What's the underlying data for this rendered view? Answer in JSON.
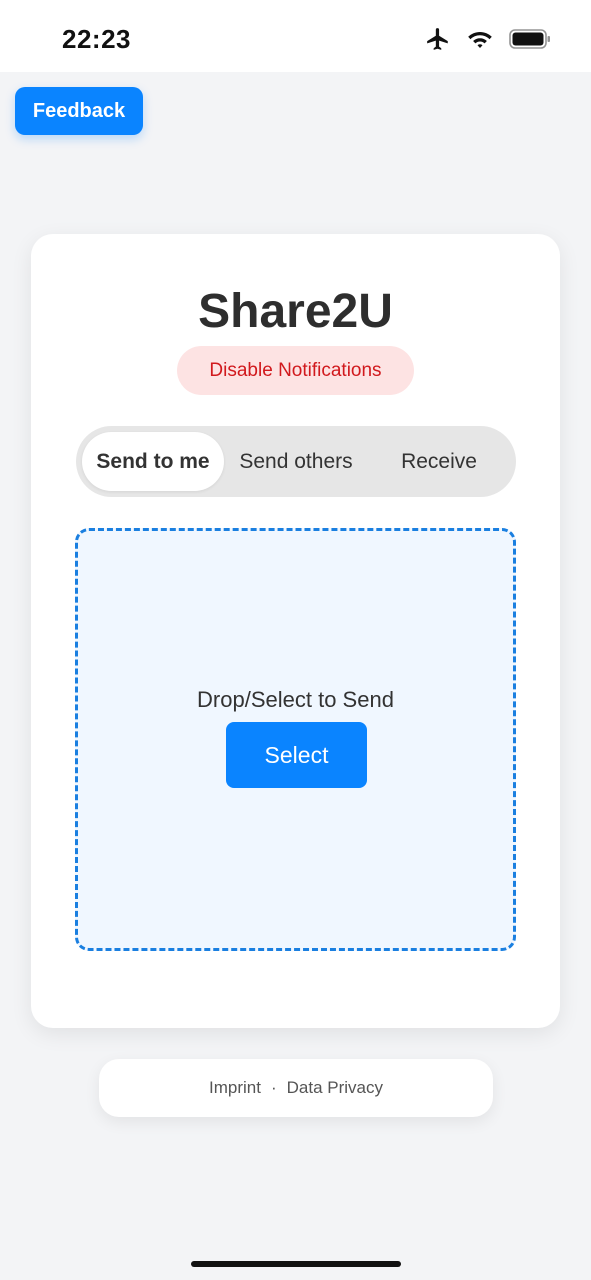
{
  "status_bar": {
    "time": "22:23",
    "icons": [
      "airplane-icon",
      "wifi-icon",
      "battery-icon"
    ]
  },
  "feedback_label": "Feedback",
  "app": {
    "title": "Share2U",
    "notifications_button": "Disable Notifications"
  },
  "tabs": [
    {
      "label": "Send to me",
      "active": true
    },
    {
      "label": "Send others",
      "active": false
    },
    {
      "label": "Receive",
      "active": false
    }
  ],
  "dropzone": {
    "label": "Drop/Select to Send",
    "select_label": "Select"
  },
  "footer": {
    "imprint": "Imprint",
    "separator": "·",
    "privacy": "Data Privacy"
  },
  "colors": {
    "accent": "#0a84ff",
    "danger_text": "#d1191d",
    "danger_bg": "#fde3e3",
    "dropzone_border": "#1a7fe0",
    "dropzone_bg": "#f0f7ff"
  }
}
